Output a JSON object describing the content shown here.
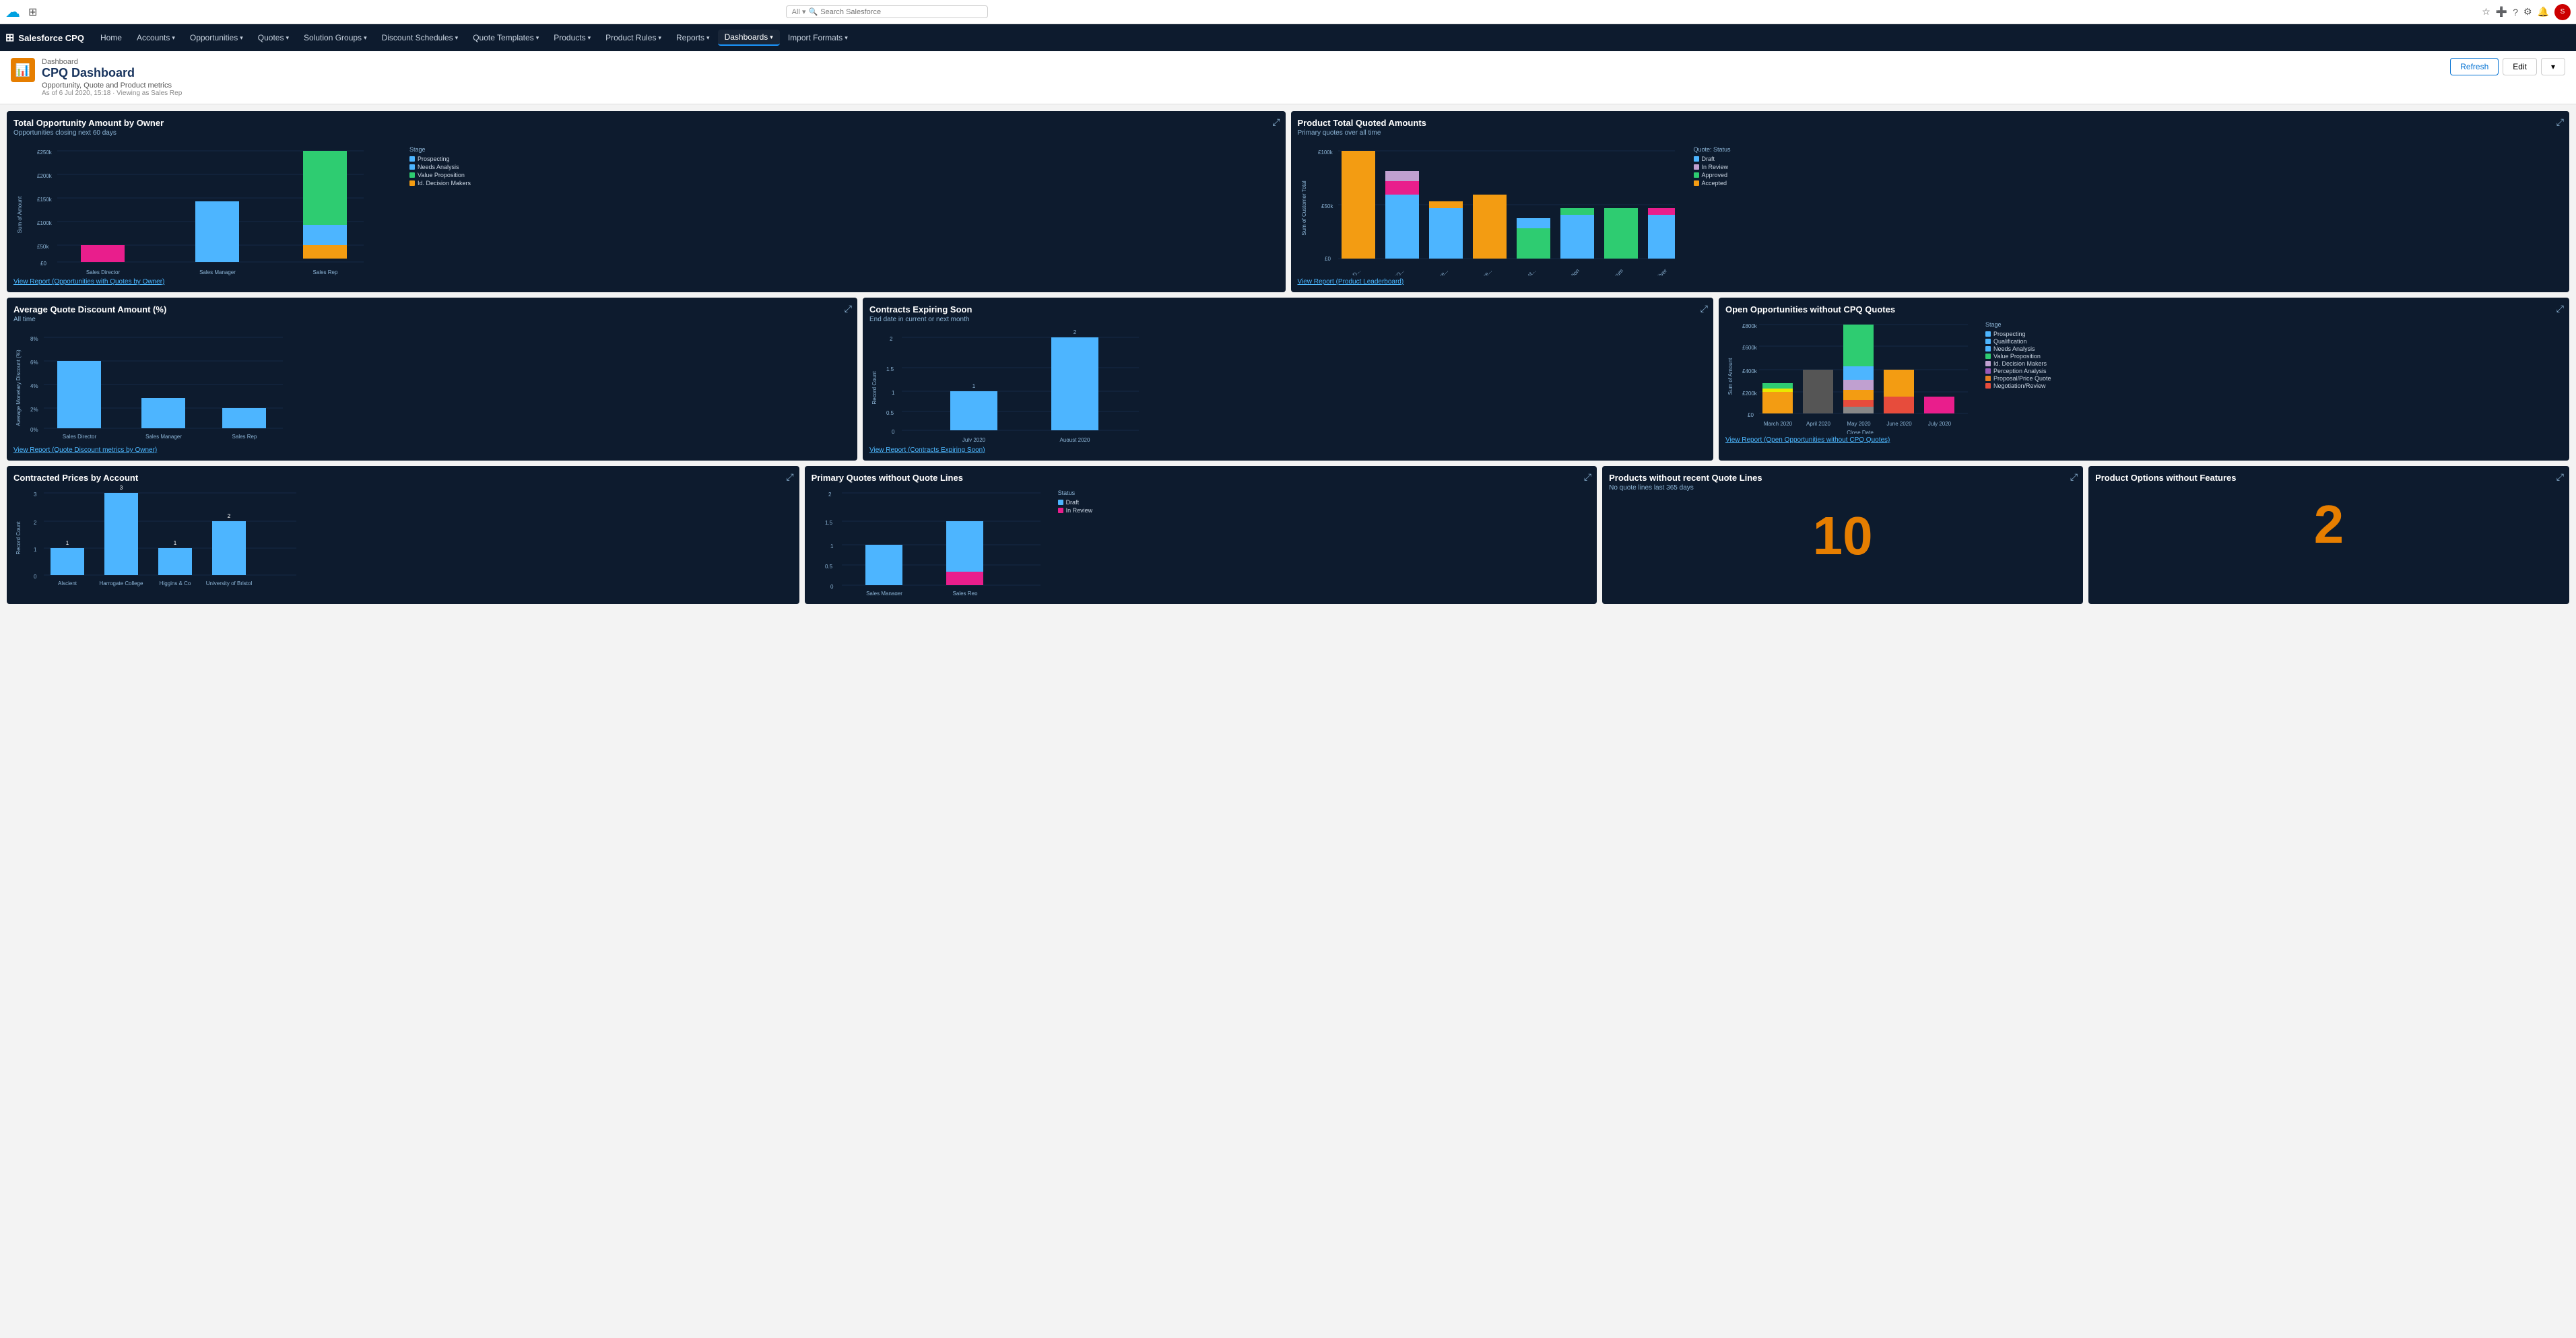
{
  "topnav": {
    "search_placeholder": "Search Salesforce",
    "all_label": "All"
  },
  "mainnav": {
    "app_name": "Salesforce CPQ",
    "items": [
      {
        "label": "Home",
        "active": false,
        "has_dropdown": false
      },
      {
        "label": "Accounts",
        "active": false,
        "has_dropdown": true
      },
      {
        "label": "Opportunities",
        "active": false,
        "has_dropdown": true
      },
      {
        "label": "Quotes",
        "active": false,
        "has_dropdown": true
      },
      {
        "label": "Solution Groups",
        "active": false,
        "has_dropdown": true
      },
      {
        "label": "Discount Schedules",
        "active": false,
        "has_dropdown": true
      },
      {
        "label": "Quote Templates",
        "active": false,
        "has_dropdown": true
      },
      {
        "label": "Products",
        "active": false,
        "has_dropdown": true
      },
      {
        "label": "Product Rules",
        "active": false,
        "has_dropdown": true
      },
      {
        "label": "Reports",
        "active": false,
        "has_dropdown": true
      },
      {
        "label": "Dashboards",
        "active": true,
        "has_dropdown": true
      },
      {
        "label": "Import Formats",
        "active": false,
        "has_dropdown": true
      }
    ]
  },
  "header": {
    "breadcrumb": "Dashboard",
    "title": "CPQ Dashboard",
    "subtitle": "Opportunity, Quote and Product metrics",
    "meta": "As of 6 Jul 2020, 15:18 · Viewing as Sales Rep",
    "refresh_label": "Refresh",
    "edit_label": "Edit"
  },
  "panels": {
    "p1_title": "Total Opportunity Amount by Owner",
    "p1_subtitle": "Opportunities closing next 60 days",
    "p1_view_report": "View Report (Opportunities with Quotes by Owner)",
    "p2_title": "Product Total Quoted Amounts",
    "p2_subtitle": "Primary quotes over all time",
    "p2_view_report": "View Report (Product Leaderboard)",
    "p3_title": "Average Quote Discount Amount (%)",
    "p3_subtitle": "All time",
    "p3_view_report": "View Report (Quote Discount metrics by Owner)",
    "p4_title": "Contracts Expiring Soon",
    "p4_subtitle": "End date in current or next month",
    "p4_view_report": "View Report (Contracts Expiring Soon)",
    "p5_title": "Open Opportunities without CPQ Quotes",
    "p5_view_report": "View Report (Open Opportunities without CPQ Quotes)",
    "p6_title": "Contracted Prices by Account",
    "p7_title": "Primary Quotes without Quote Lines",
    "p8_title": "Products without recent Quote Lines",
    "p8_subtitle": "No quote lines last 365 days",
    "p8_value": "10",
    "p9_title": "Product Options without Features",
    "p9_value": "2"
  },
  "legends": {
    "opp_stages": [
      {
        "label": "Prospecting",
        "color": "#4db5ff"
      },
      {
        "label": "Needs Analysis",
        "color": "#4db5ff"
      },
      {
        "label": "Value Proposition",
        "color": "#2ecc71"
      },
      {
        "label": "Id. Decision Makers",
        "color": "#f39c12"
      }
    ],
    "quote_status": [
      {
        "label": "Draft",
        "color": "#4db5ff"
      },
      {
        "label": "In Review",
        "color": "#c0a0d0"
      },
      {
        "label": "Approved",
        "color": "#2ecc71"
      },
      {
        "label": "Accepted",
        "color": "#f39c12"
      }
    ],
    "open_opp_stages": [
      {
        "label": "Prospecting",
        "color": "#4db5ff"
      },
      {
        "label": "Qualification",
        "color": "#4db5ff"
      },
      {
        "label": "Needs Analysis",
        "color": "#4db5ff"
      },
      {
        "label": "Value Proposition",
        "color": "#2ecc71"
      },
      {
        "label": "Id. Decision Makers",
        "color": "#c0a0d0"
      },
      {
        "label": "Perception Analysis",
        "color": "#9b59b6"
      },
      {
        "label": "Proposal/Price Quote",
        "color": "#e67e22"
      },
      {
        "label": "Negotiation/Review",
        "color": "#e74c3c"
      }
    ],
    "quote_status2": [
      {
        "label": "Draft",
        "color": "#4db5ff"
      },
      {
        "label": "In Review",
        "color": "#e91e8c"
      }
    ]
  }
}
